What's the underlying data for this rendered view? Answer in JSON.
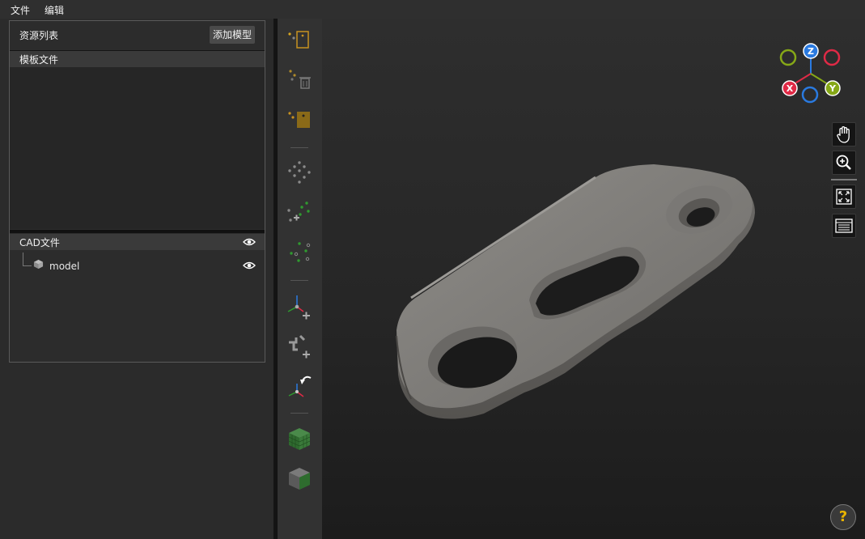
{
  "menu": {
    "file": "文件",
    "edit": "编辑"
  },
  "resource_panel": {
    "title": "资源列表",
    "add_model_label": "添加模型",
    "template_section_title": "模板文件",
    "cad_section_title": "CAD文件",
    "cad_items": [
      {
        "name": "model"
      }
    ]
  },
  "toolbar": {
    "tools": [
      "add-point-icon",
      "delete-point-icon",
      "select-point-icon",
      "point-cloud-icon",
      "add-points-icon",
      "sample-points-icon",
      "add-frame-icon",
      "add-pick-point-icon",
      "rotate-frame-icon",
      "model-cube-icon",
      "model-cube-icon-2"
    ]
  },
  "viewport": {
    "axes": {
      "x": "X",
      "y": "Y",
      "z": "Z"
    },
    "help_label": "?"
  },
  "colors": {
    "accent": "#e8b400",
    "axis_x": "#e02a46",
    "axis_y": "#86a817",
    "axis_z": "#2a7ae0"
  }
}
